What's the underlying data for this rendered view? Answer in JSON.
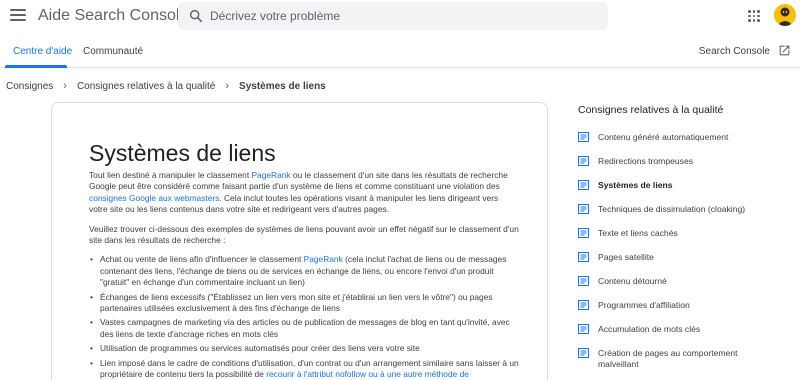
{
  "header": {
    "app_title": "Aide Search Console",
    "search_placeholder": "Décrivez votre problème"
  },
  "tabs": {
    "items": [
      {
        "label": "Centre d'aide",
        "active": true
      },
      {
        "label": "Communauté",
        "active": false
      }
    ],
    "search_console_link": "Search Console"
  },
  "breadcrumb": {
    "items": [
      "Consignes",
      "Consignes relatives à la qualité",
      "Systèmes de liens"
    ]
  },
  "article": {
    "title": "Systèmes de liens",
    "intro": {
      "t1": "Tout lien destiné à manipuler le classement ",
      "l1": "PageRank",
      "t2": " ou le classement d'un site dans les résultats de recherche Google peut être considéré comme faisant partie d'un système de liens et comme constituant une violation des ",
      "l2": "consignes Google aux webmasters",
      "t3": ". Cela inclut toutes les opérations visant à manipuler les liens dirigeant vers votre site ou les liens contenus dans votre site et redirigeant vers d'autres pages."
    },
    "p2": "Veuillez trouver ci-dessous des exemples de systèmes de liens pouvant avoir un effet négatif sur le classement d'un site dans les résultats de recherche :",
    "bullets": {
      "b1_t1": "Achat ou vente de liens afin d'influencer le classement ",
      "b1_link": "PageRank",
      "b1_t2": " (cela inclut l'achat de liens ou de messages contenant des liens, l'échange de biens ou de services en échange de liens, ou encore l'envoi d'un produit \"gratuit\" en échange d'un commentaire incluant un lien)",
      "b2": "Échanges de liens excessifs (\"Établissez un lien vers mon site et j'établirai un lien vers le vôtre\") ou pages partenaires utilisées exclusivement à des fins d'échange de liens",
      "b3": "Vastes campagnes de marketing via des articles ou de publication de messages de blog en tant qu'invité, avec des liens de texte d'ancrage riches en mots clés",
      "b4": "Utilisation de programmes ou services automatisés pour créer des liens vers votre site",
      "b5_t1": "Lien imposé dans le cadre de conditions d'utilisation, d'un contrat ou d'un arrangement similaire sans laisser à un propriétaire de contenu tiers la possibilité de ",
      "b5_link": "recourir à l'attribut nofollow ou à une autre méthode de"
    }
  },
  "sidenav": {
    "title": "Consignes relatives à la qualité",
    "items": [
      {
        "label": "Contenu généré automatiquement",
        "active": false
      },
      {
        "label": "Redirections trompeuses",
        "active": false
      },
      {
        "label": "Systèmes de liens",
        "active": true
      },
      {
        "label": "Techniques de dissimulation (cloaking)",
        "active": false
      },
      {
        "label": "Texte et liens cachés",
        "active": false
      },
      {
        "label": "Pages satellite",
        "active": false
      },
      {
        "label": "Contenu détourné",
        "active": false
      },
      {
        "label": "Programmes d'affiliation",
        "active": false
      },
      {
        "label": "Accumulation de mots clés",
        "active": false
      },
      {
        "label": "Création de pages au comportement malveillant",
        "active": false
      }
    ]
  },
  "colors": {
    "accent": "#1a73e8",
    "text": "#202124",
    "muted": "#5f6368",
    "search_bg": "#f1f3f4"
  }
}
